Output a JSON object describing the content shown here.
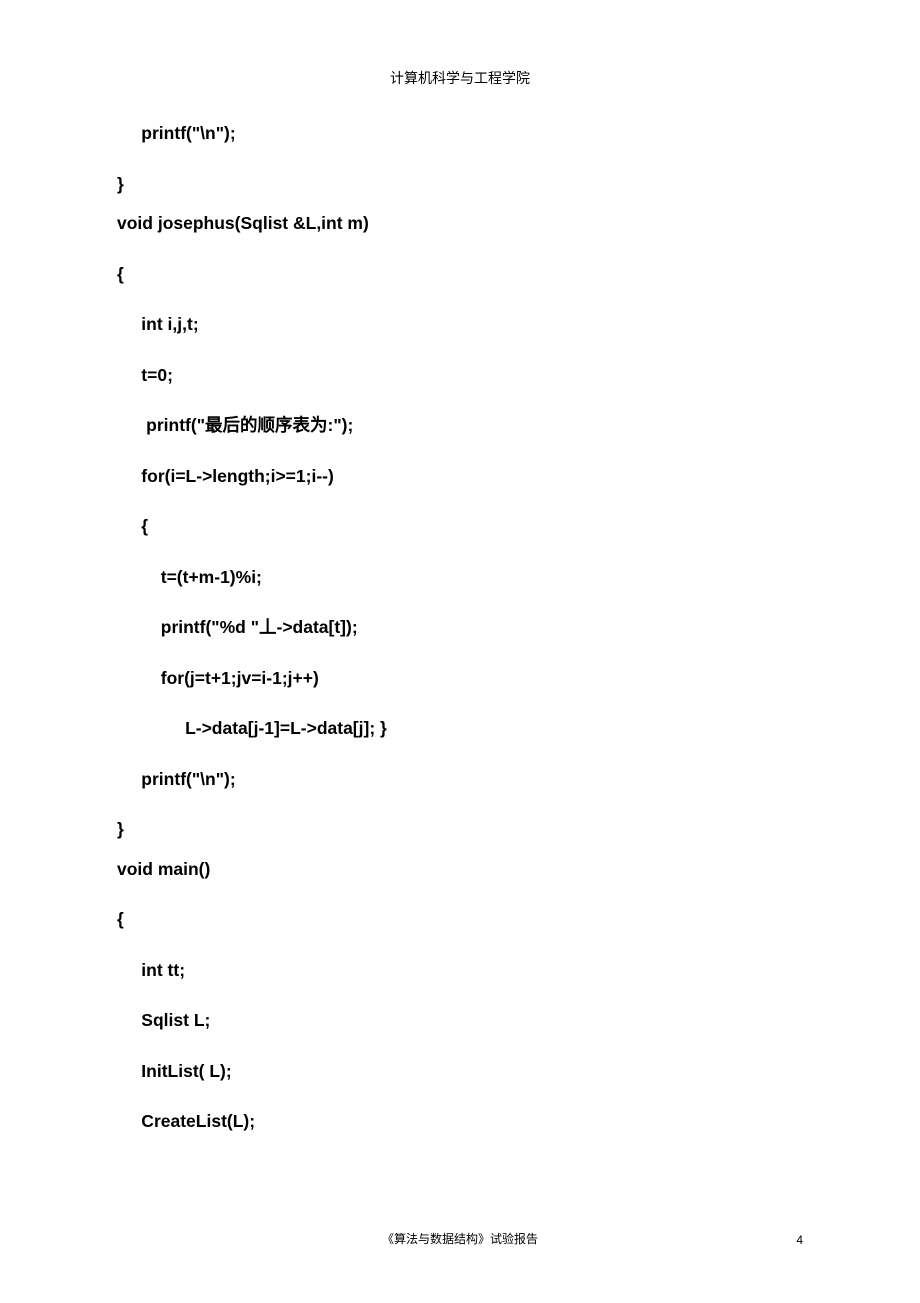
{
  "header": "计算机科学与工程学院",
  "footer_text": "《算法与数据结构》试验报告",
  "page_number": "4",
  "code": {
    "lines": [
      "     printf(\"\\n\");",
      "}",
      "void josephus(Sqlist &L,int m)",
      "{",
      "     int i,j,t;",
      "     t=0;",
      "      printf(\"最后的顺序表为:\");",
      "     for(i=L->length;i>=1;i--)",
      "     {",
      "         t=(t+m-1)%i;",
      "         printf(\"%d \"丄->data[t]);",
      "         for(j=t+1;jv=i-1;j++)",
      "              L->data[j-1]=L->data[j]; }",
      "     printf(\"\\n\");",
      "}",
      "void main()",
      "{",
      "     int tt;",
      "     Sqlist L;",
      "     InitList( L);",
      "     CreateList(L);"
    ]
  }
}
